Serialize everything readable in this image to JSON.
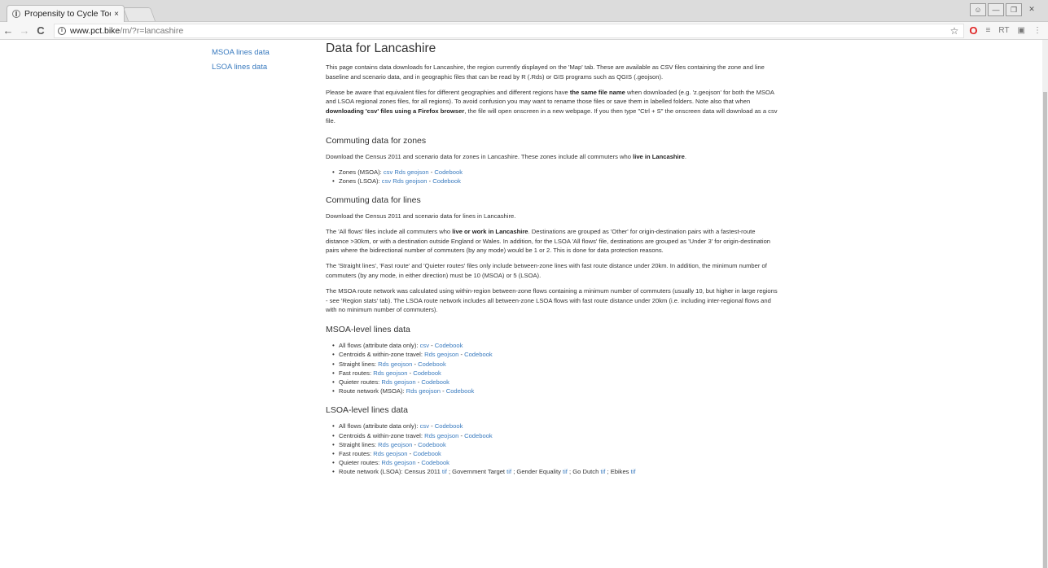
{
  "browser": {
    "tab_title": "Propensity to Cycle Tool",
    "tab_close": "×",
    "url_host": "www.pct.bike",
    "url_path": "/m/?r=lancashire",
    "ext_rt": "RT"
  },
  "sidebar": {
    "items": [
      {
        "label": "MSOA lines data"
      },
      {
        "label": "LSOA lines data"
      }
    ]
  },
  "main": {
    "title": "Data for Lancashire",
    "intro": "This page contains data downloads for Lancashire, the region currently displayed on the 'Map' tab. These are available as CSV files containing the zone and line baseline and scenario data, and in geographic files that can be read by R (.Rds) or GIS programs such as QGIS (.geojson).",
    "warn_a": "Please be aware that equivalent files for different geographies and different regions have ",
    "warn_b": "the same file name",
    "warn_c": " when downloaded (e.g. 'z.geojson' for both the MSOA and LSOA regional zones files, for all regions). To avoid confusion you may want to rename those files or save them in labelled folders. Note also that when ",
    "warn_d": "downloading 'csv' files using a Firefox browser",
    "warn_e": ", the file will open onscreen in a new webpage. If you then type \"Ctrl + S\" the onscreen data will download as a csv file.",
    "zones_heading": "Commuting data for zones",
    "zones_desc_a": "Download the Census 2011 and scenario data for zones in Lancashire. These zones include all commuters who ",
    "zones_desc_b": "live in Lancashire",
    "zones_desc_c": ".",
    "zones_items": [
      {
        "label": "Zones (MSOA): "
      },
      {
        "label": "Zones (LSOA): "
      }
    ],
    "lines_heading": "Commuting data for lines",
    "lines_desc": "Download the Census 2011 and scenario data for lines in Lancashire.",
    "allflows_a": "The 'All flows' files include all commuters who ",
    "allflows_b": "live or work in Lancashire",
    "allflows_c": ". Destinations are grouped as 'Other' for origin-destination pairs with a fastest-route distance >30km, or with a destination outside England or Wales. In addition, for the LSOA 'All flows' file, destinations are grouped as 'Under 3' for origin-destination pairs where the bidirectional number of commuters (by any mode) would be 1 or 2. This is done for data protection reasons.",
    "straight_p": "The 'Straight lines', 'Fast route' and 'Quieter routes' files only include between-zone lines with fast route distance under 20km. In addition, the minimum number of commuters (by any mode, in either direction) must be 10 (MSOA) or 5 (LSOA).",
    "network_p": "The MSOA route network was calculated using within-region between-zone flows containing a minimum number of commuters (usually 10, but higher in large regions - see 'Region stats' tab). The LSOA route network includes all between-zone LSOA flows with fast route distance under 20km (i.e. including inter-regional flows and with no minimum number of commuters).",
    "msoa_heading": "MSOA-level lines data",
    "lsoa_heading": "LSOA-level lines data",
    "lbl_allflows": "All flows (attribute data only): ",
    "lbl_centroids": "Centroids & within-zone travel: ",
    "lbl_straight": "Straight lines: ",
    "lbl_fast": "Fast routes: ",
    "lbl_quieter": "Quieter routes: ",
    "lbl_network_msoa": "Route network (MSOA): ",
    "lbl_network_lsoa": "Route network (LSOA): ",
    "lsoa_net_a": "Census 2011 ",
    "lsoa_net_b": " ; Government Target ",
    "lsoa_net_c": " ; Gender Equality ",
    "lsoa_net_d": " ; Go Dutch ",
    "lsoa_net_e": " ; Ebikes ",
    "link_csv": "csv",
    "link_rds": "Rds",
    "link_geojson": "geojson",
    "link_codebook": "Codebook",
    "link_tif": "tif",
    "sep_dash": " - ",
    "sep_space": " "
  },
  "colors": {
    "link": "#3a7bbf",
    "text": "#333333"
  }
}
